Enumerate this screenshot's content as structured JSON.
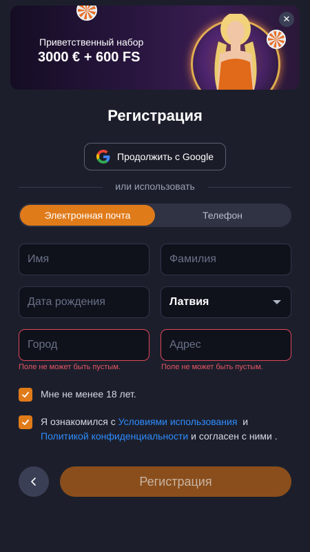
{
  "banner": {
    "subtitle": "Приветственный набор",
    "title": "3000 € + 600 FS",
    "close_glyph": "✕"
  },
  "page": {
    "title": "Регистрация"
  },
  "google": {
    "label": "Продолжить с Google",
    "icon": "google-icon"
  },
  "divider": {
    "text": "или использовать"
  },
  "tabs": [
    {
      "label": "Электронная почта",
      "active": true
    },
    {
      "label": "Телефон",
      "active": false
    }
  ],
  "form": {
    "first_name_placeholder": "Имя",
    "last_name_placeholder": "Фамилия",
    "birthdate_placeholder": "Дата рождения",
    "country_value": "Латвия",
    "city_placeholder": "Город",
    "address_placeholder": "Адрес",
    "city_error": "Поле не может быть пустым.",
    "address_error": "Поле не может быть пустым."
  },
  "consents": {
    "age_label": "Мне не менее 18 лет.",
    "terms_prefix": "Я ознакомился с",
    "terms_link": "Условиями использования",
    "terms_and": "и",
    "privacy_link": "Политикой конфиденциальности",
    "terms_suffix": "и согласен с ними ."
  },
  "actions": {
    "back_icon": "chevron-left-icon",
    "submit_label": "Регистрация"
  },
  "colors": {
    "accent": "#e07b1a",
    "background": "#1c1f2b",
    "error": "#e85566",
    "link": "#2f8cff"
  }
}
